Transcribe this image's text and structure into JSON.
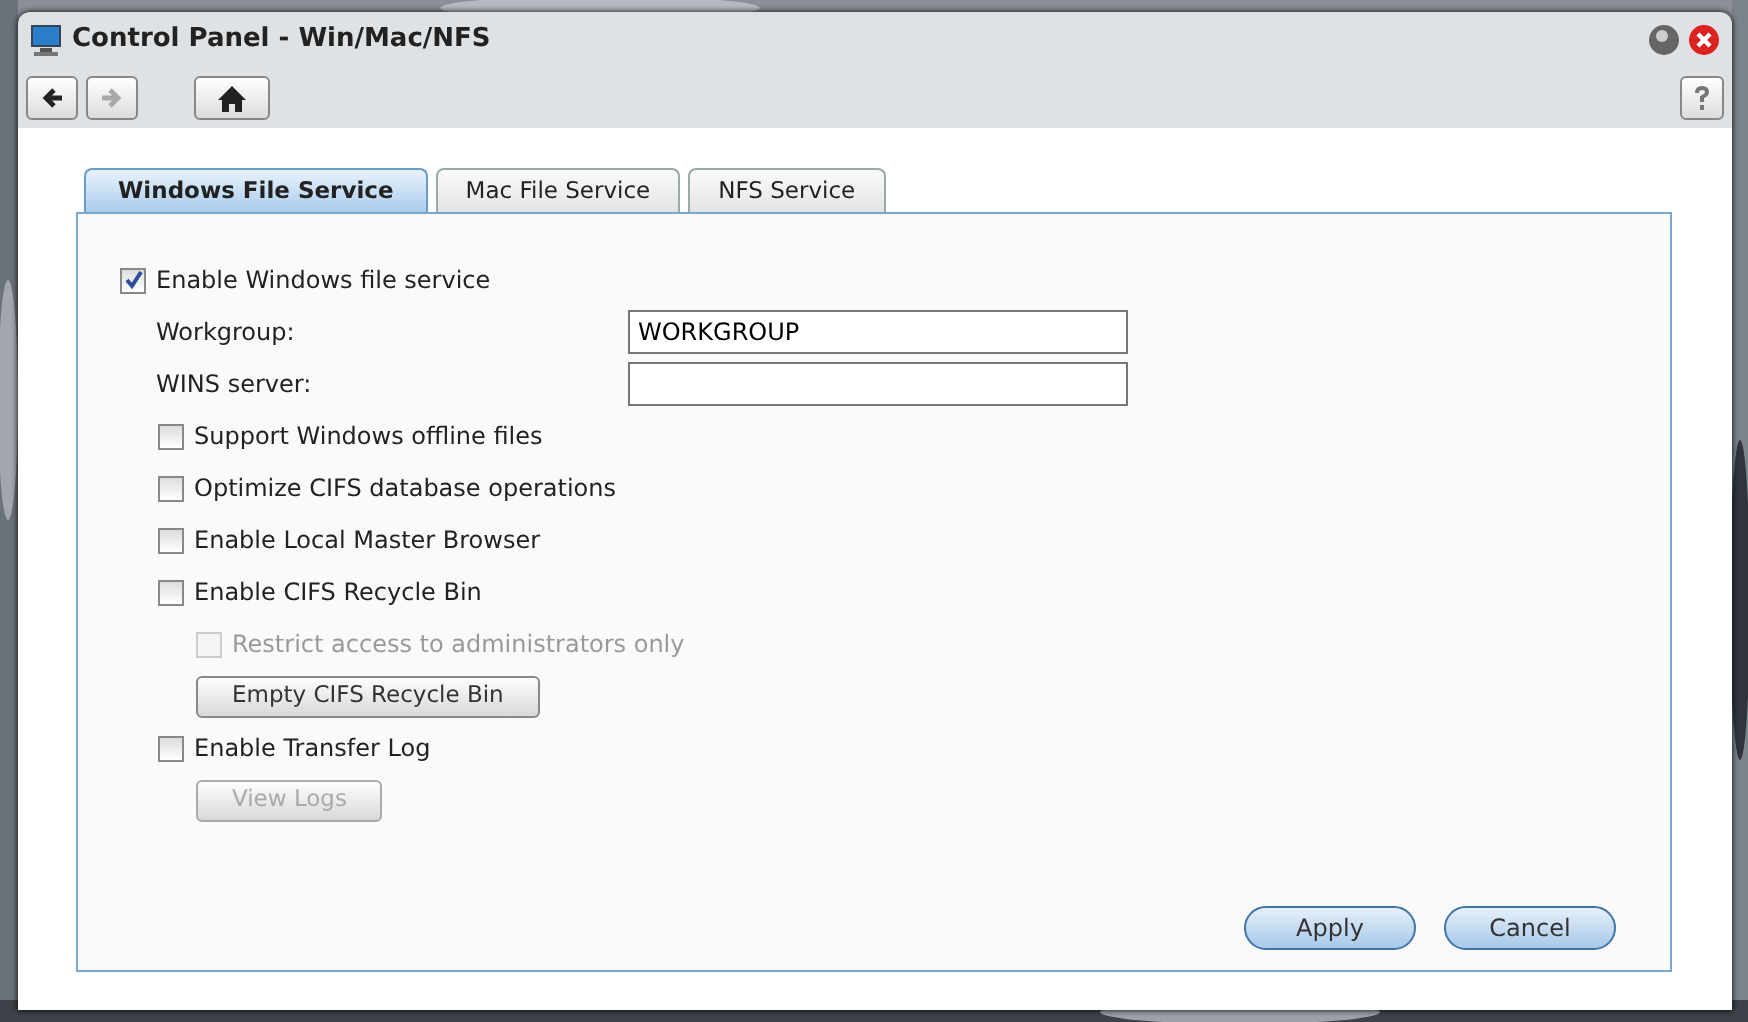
{
  "window": {
    "title": "Control Panel - Win/Mac/NFS"
  },
  "toolbar": {
    "back_disabled": false,
    "forward_disabled": true
  },
  "tabs": [
    {
      "label": "Windows File Service",
      "selected": true
    },
    {
      "label": "Mac File Service",
      "selected": false
    },
    {
      "label": "NFS Service",
      "selected": false
    }
  ],
  "enable_service": {
    "label": "Enable Windows file service",
    "checked": true
  },
  "fields": [
    {
      "label": "Workgroup:",
      "value": "WORKGROUP"
    },
    {
      "label": "WINS server:"
    }
  ],
  "options": [
    {
      "kind": "checkbox",
      "label": "Support Windows offline files",
      "checked": false,
      "disabled": false
    },
    {
      "kind": "checkbox",
      "label": "Optimize CIFS database operations",
      "checked": false,
      "disabled": false
    },
    {
      "kind": "checkbox",
      "label": "Enable Local Master Browser",
      "checked": false,
      "disabled": false
    },
    {
      "kind": "checkbox",
      "label": "Enable CIFS Recycle Bin",
      "checked": false,
      "disabled": false,
      "children": [
        {
          "kind": "checkbox",
          "label": "Restrict access to administrators only",
          "checked": false,
          "disabled": true
        },
        {
          "kind": "button",
          "label": "Empty CIFS Recycle Bin",
          "disabled": false
        }
      ]
    },
    {
      "kind": "checkbox",
      "label": "Enable Transfer Log",
      "checked": false,
      "disabled": false,
      "children": [
        {
          "kind": "button",
          "label": "View Logs",
          "disabled": true
        }
      ]
    }
  ],
  "buttons": [
    "Apply",
    "Cancel"
  ]
}
